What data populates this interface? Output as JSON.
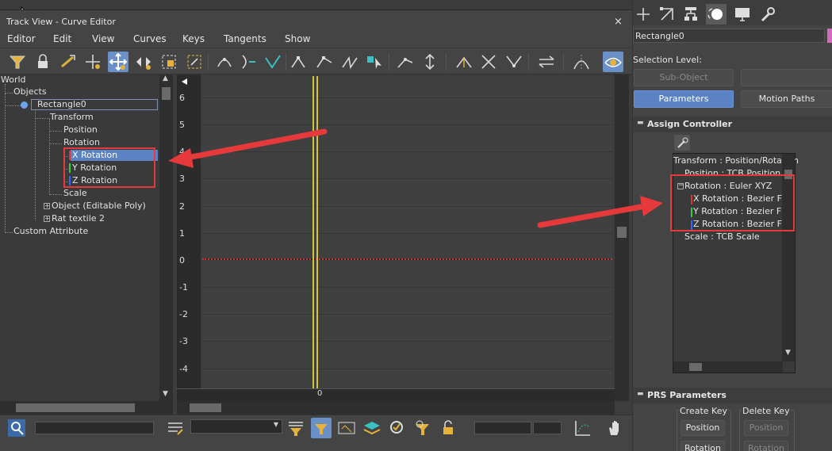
{
  "window": {
    "title": "Track View - Curve Editor",
    "close_glyph": "×"
  },
  "menu": [
    "Editor",
    "Edit",
    "View",
    "Curves",
    "Keys",
    "Tangents",
    "Show"
  ],
  "tree": {
    "world": "World",
    "objects": "Objects",
    "rectangle": "Rectangle0",
    "transform": "Transform",
    "position": "Position",
    "rotation": "Rotation",
    "x_rotation": "X Rotation",
    "y_rotation": "Y Rotation",
    "z_rotation": "Z Rotation",
    "scale": "Scale",
    "object": "Object (Editable Poly)",
    "rat": "Rat textile 2",
    "custom": "Custom Attribute",
    "expand_glyph": "+"
  },
  "graph": {
    "y_ticks": [
      "6",
      "5",
      "4",
      "3",
      "2",
      "1",
      "0",
      "-1",
      "-2",
      "-3",
      "-4"
    ],
    "x_tick": "0",
    "curve_color": "#cc3333",
    "timeline_color": "#d4c43a"
  },
  "command_panel": {
    "object_name": "Rectangle0",
    "selection_level": "Selection Level:",
    "sub_object": "Sub-Object",
    "parameters": "Parameters",
    "motion_paths": "Motion Paths",
    "assign_controller": "Assign Controller",
    "controllers": {
      "transform": "Transform : Position/Rotation",
      "position": "Position : TCB Position",
      "rotation": "Rotation : Euler XYZ",
      "x": "X Rotation : Bezier Float",
      "y": "Y Rotation : Bezier Float",
      "z": "Z Rotation : Bezier Float",
      "scale": "Scale : TCB Scale"
    },
    "prs_parameters": "PRS Parameters",
    "create_key": "Create Key",
    "delete_key": "Delete Key",
    "create_position": "Position",
    "create_rotation": "Rotation",
    "delete_position": "Position",
    "delete_rotation": "Rotation",
    "collapse_glyph": "▬"
  },
  "colors": {
    "accent": "#5b82c4",
    "annotation": "#e5393b",
    "object_swatch": "#d36bbd"
  }
}
